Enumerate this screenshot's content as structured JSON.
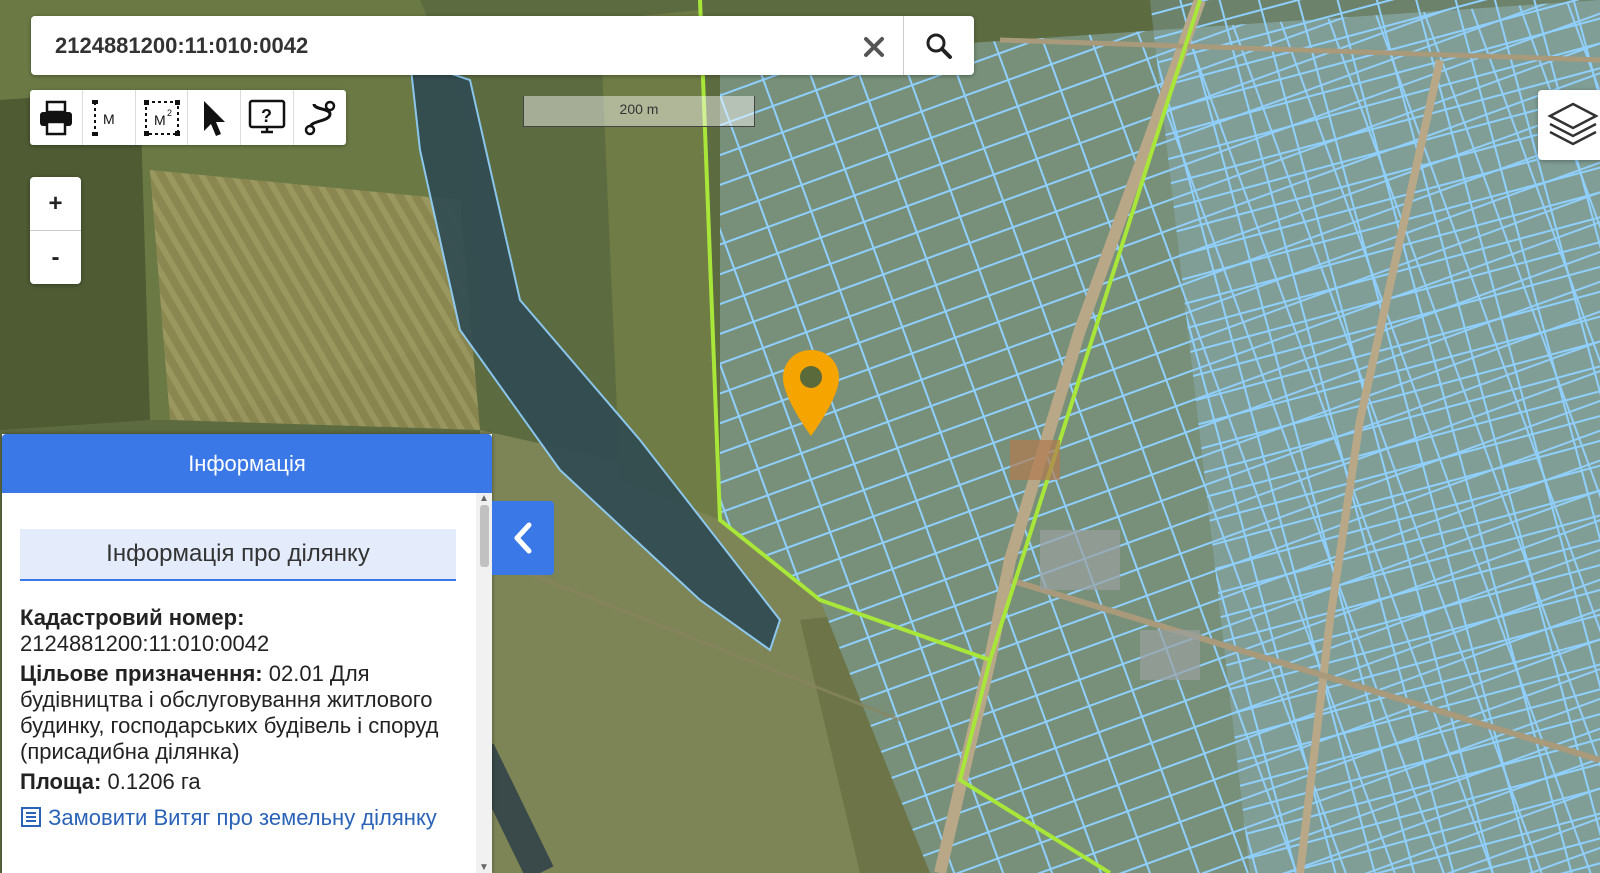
{
  "search": {
    "value": "2124881200:11:010:0042",
    "placeholder": ""
  },
  "icons": {
    "clear": "close-icon",
    "search": "search-icon",
    "layers": "layers-icon",
    "print": "print-icon",
    "measure_length": "measure-length-icon",
    "measure_area": "measure-area-icon",
    "select": "pointer-icon",
    "help": "help-icon",
    "route": "route-icon",
    "marker": "map-marker-icon",
    "collapse": "chevron-left-icon",
    "order": "document-icon"
  },
  "toolbar": {
    "length_label": "M",
    "area_label": "M"
  },
  "zoom": {
    "in_label": "+",
    "out_label": "-"
  },
  "scale": {
    "label": "200 m"
  },
  "info": {
    "header": "Інформація",
    "subheader": "Інформація про ділянку",
    "cadastral_label": "Кадастровий номер:",
    "cadastral_value": "2124881200:11:010:0042",
    "purpose_label": "Цільове призначення:",
    "purpose_value": "02.01 Для будівництва і обслуговування житлового будинку, господарських будівель і споруд (присадибна ділянка)",
    "area_label": "Площа:",
    "area_value": "0.1206 га",
    "order_link": "Замовити Витяг про земельну ділянку"
  },
  "colors": {
    "accent": "#3b78e7",
    "marker": "#f5a400",
    "parcel_outline": "#8fd0ff",
    "boundary": "#a8e63a",
    "link": "#2a63b8"
  }
}
